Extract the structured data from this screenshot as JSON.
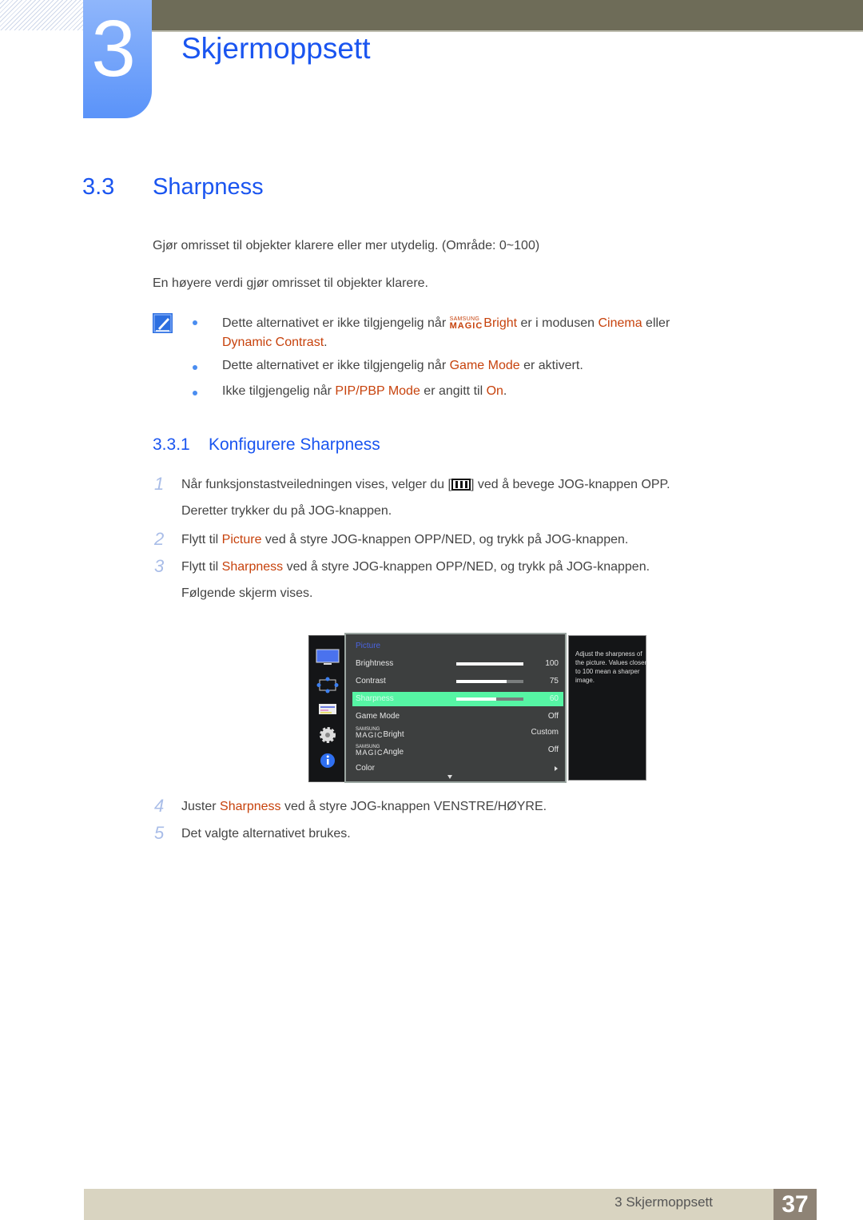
{
  "chapter": {
    "number": "3",
    "title": "Skjermoppsett"
  },
  "section": {
    "number": "3.3",
    "title": "Sharpness"
  },
  "intro": [
    "Gjør omrisset til objekter klarere eller mer utydelig. (Område: 0~100)",
    "En høyere verdi gjør omrisset til objekter klarere."
  ],
  "notes": {
    "icon": "note-pencil-icon",
    "n1": {
      "a": "Dette alternativet er ikke tilgjengelig når ",
      "magic_s": "SAMSUNG",
      "magic_m": "MAGIC",
      "b": "Bright",
      "c": " er i modusen ",
      "d": "Cinema",
      "e": " eller",
      "f": "Dynamic Contrast",
      "g": "."
    },
    "n2": {
      "a": "Dette alternativet er ikke tilgjengelig når ",
      "b": "Game Mode",
      "c": " er aktivert."
    },
    "n3": {
      "a": "Ikke tilgjengelig når ",
      "b": "PIP/PBP Mode",
      "c": " er angitt til ",
      "d": "On",
      "e": "."
    }
  },
  "subsection": {
    "number": "3.3.1",
    "title": "Konfigurere Sharpness"
  },
  "steps": {
    "s1": {
      "num": "1",
      "a": "Når funksjonstastveiledningen vises, velger du [",
      "b": "] ved å bevege JOG-knappen OPP.",
      "c": "Deretter trykker du på JOG-knappen."
    },
    "s2": {
      "num": "2",
      "a": "Flytt til ",
      "b": "Picture",
      "c": " ved å styre JOG-knappen OPP/NED, og trykk på JOG-knappen."
    },
    "s3": {
      "num": "3",
      "a": "Flytt til ",
      "b": "Sharpness",
      "c": " ved å styre JOG-knappen OPP/NED, og trykk på JOG-knappen.",
      "d": "Følgende skjerm vises."
    },
    "s4": {
      "num": "4",
      "a": "Juster ",
      "b": "Sharpness",
      "c": " ved å styre JOG-knappen VENSTRE/HØYRE."
    },
    "s5": {
      "num": "5",
      "a": "Det valgte alternativet brukes."
    }
  },
  "osd": {
    "header": "Picture",
    "side_icons": [
      "monitor-icon",
      "size-position-icon",
      "setup-icon",
      "gear-icon",
      "info-icon"
    ],
    "rows": [
      {
        "label": "Brightness",
        "value": "100",
        "bar": 100
      },
      {
        "label": "Contrast",
        "value": "75",
        "bar": 75
      },
      {
        "label": "Sharpness",
        "value": "60",
        "bar": 60,
        "selected": true
      },
      {
        "label": "Game Mode",
        "value": "Off"
      },
      {
        "magic_s": "SAMSUNG",
        "magic_m": "MAGIC",
        "label": "Bright",
        "value": "Custom"
      },
      {
        "magic_s": "SAMSUNG",
        "magic_m": "MAGIC",
        "label": "Angle",
        "value": "Off"
      },
      {
        "label": "Color",
        "value": ""
      }
    ],
    "description": "Adjust the sharpness of the picture. Values closer to 100 mean a sharper image."
  },
  "footer": {
    "text": "3 Skjermoppsett",
    "page": "37"
  },
  "colors": {
    "heading_blue": "#1a55f0",
    "highlight": "#c7420c",
    "footer_bg": "#d9d4c1",
    "osd_select": "#56f5a4"
  }
}
